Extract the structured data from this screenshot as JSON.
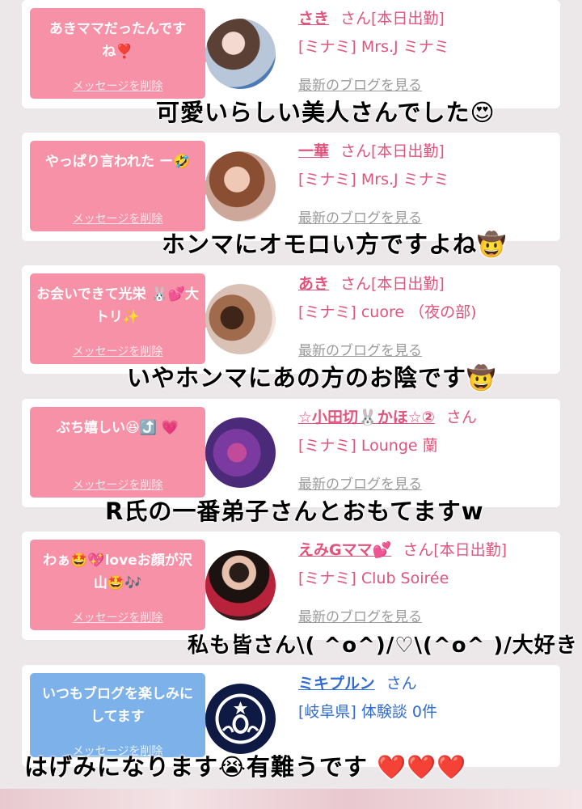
{
  "cards": [
    {
      "bubble_text": "あきママだったんですね❣️",
      "delete_label": "メッセージを削除",
      "name": "さき",
      "suffix": "さん[本日出勤]",
      "shop": "[ミナミ] Mrs.J ミナミ",
      "blog_link": "最新のブログを見る",
      "caption": "可愛いらしい美人さんでした😍"
    },
    {
      "bubble_text": "やっぱり言われた ー🤣",
      "delete_label": "メッセージを削除",
      "name": "一華",
      "suffix": "さん[本日出勤]",
      "shop": "[ミナミ] Mrs.J ミナミ",
      "blog_link": "最新のブログを見る",
      "caption": "ホンマにオモロい方ですよね🤠"
    },
    {
      "bubble_text": "お会いできて光栄 🐰💕大トリ✨",
      "delete_label": "メッセージを削除",
      "name": "あき",
      "suffix": "さん[本日出勤]",
      "shop": "[ミナミ] cuore （夜の部)",
      "blog_link": "最新のブログを見る",
      "caption": "いやホンマにあの方のお陰です🤠"
    },
    {
      "bubble_text": "ぶち嬉しい😆⤴️ 💗",
      "delete_label": "メッセージを削除",
      "name": "☆小田切🐰かほ☆②",
      "suffix": "さん",
      "shop": "[ミナミ] Lounge 蘭",
      "blog_link": "最新のブログを見る",
      "caption": "R氏の一番弟子さんとおもてますw"
    },
    {
      "bubble_text": "わぁ🤩💖loveお顔が沢山🤩🎶",
      "delete_label": "メッセージを削除",
      "name": "えみGママ💕",
      "suffix": "さん[本日出勤]",
      "shop": "[ミナミ] Club Soirée",
      "blog_link": "最新のブログを見る",
      "caption": "私も皆さん\\( ^o^)/♡\\(^o^ )/大好き"
    },
    {
      "bubble_text": "いつもブログを楽しみにしてます",
      "delete_label": "メッセージを削除",
      "name": "ミキプルン",
      "suffix": "さん",
      "shop": "[岐阜県] 体験談 0件",
      "caption": "はげみになります😭有難うです ❤️❤️❤️"
    }
  ],
  "colors": {
    "accent_pink": "#e0547c",
    "bubble_pink": "#f691a7",
    "bubble_blue": "#7db1ea",
    "accent_blue": "#2f6bd1"
  }
}
